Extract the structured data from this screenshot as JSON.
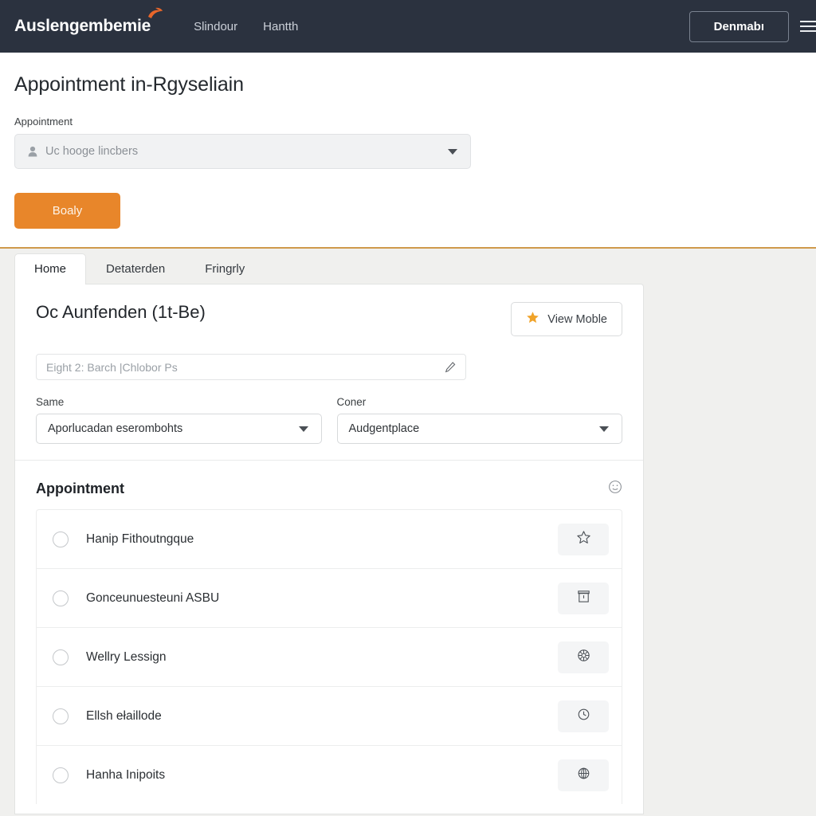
{
  "navbar": {
    "brand": "Auslengembemie",
    "links": [
      {
        "label": "Slindour"
      },
      {
        "label": "Hantth"
      }
    ],
    "button": "Denmabı",
    "menu_icon": "hamburger-icon",
    "bg_color": "#2b323f"
  },
  "page": {
    "title": "Appointment in-Rgyseliain",
    "field_label": "Appointment",
    "select_value": "Uc hooge lincbers",
    "select_icon": "person-icon",
    "primary_button": "Boaly",
    "accent_color": "#e8862a",
    "rule_color": "#cf9a4c"
  },
  "tabs": [
    {
      "label": "Home",
      "active": true
    },
    {
      "label": "Detaterden",
      "active": false
    },
    {
      "label": "Fringrly",
      "active": false
    }
  ],
  "card": {
    "title": "Oc Aunfenden (1t-Be)",
    "view_button": {
      "label": "View Moble",
      "icon": "star-icon"
    },
    "text_input": {
      "value": "Eight 2: Barch |Chlobor Ps",
      "icon": "pencil-icon"
    },
    "fields": [
      {
        "label": "Same",
        "value": "Aporlucadan eserombohts"
      },
      {
        "label": "Coner",
        "value": "Audgentplace"
      }
    ]
  },
  "section": {
    "title": "Appointment",
    "action_icon": "smiley-icon"
  },
  "list_items": [
    {
      "label": "Hanip Fithoutngque",
      "icon": "star-icon"
    },
    {
      "label": "Gonceunuesteuni ASBU",
      "icon": "archive-icon"
    },
    {
      "label": "Wellry Lessign",
      "icon": "gear-icon"
    },
    {
      "label": "Ellsh ełaillode",
      "icon": "clock-icon"
    },
    {
      "label": "Hanha Inipoits",
      "icon": "globe-icon"
    }
  ]
}
